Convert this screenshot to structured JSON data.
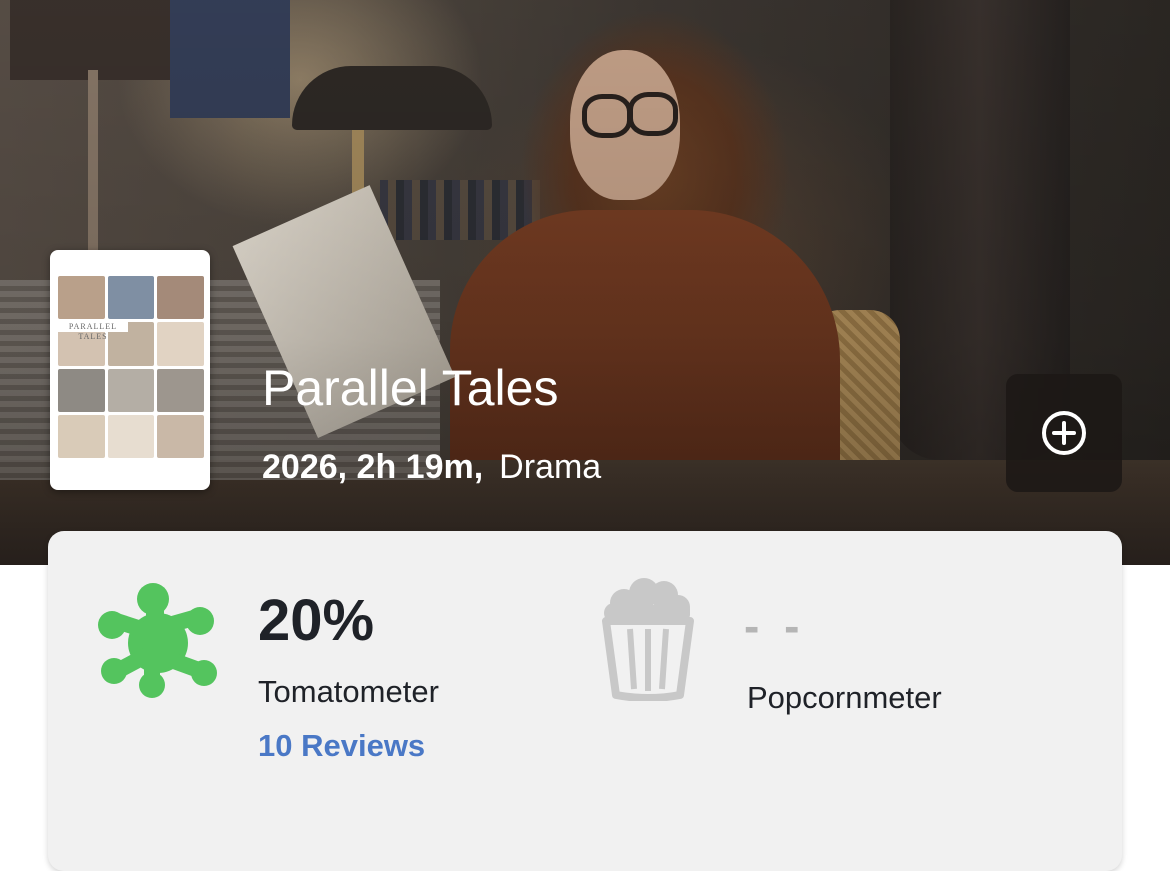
{
  "movie": {
    "title": "Parallel Tales",
    "year_runtime": "2026, 2h 19m,",
    "genre": "Drama",
    "poster": {
      "title_text": "PARALLEL TALES",
      "palette": [
        "#b9a08a",
        "#7f8fa3",
        "#a48a79",
        "#d3c2b1",
        "#c1b2a0",
        "#e1d3c3",
        "#8e8a84",
        "#b4aea5",
        "#9d968e",
        "#d9cbb8",
        "#e7ddd0",
        "#c9b8a7"
      ]
    }
  },
  "actions": {
    "add_icon": "plus-circle-icon"
  },
  "scores": {
    "tomatometer": {
      "value": "20%",
      "label": "Tomatometer",
      "reviews": "10 Reviews",
      "icon": "rotten-splat-icon",
      "icon_color": "#54c45e"
    },
    "popcornmeter": {
      "value": "- -",
      "label": "Popcornmeter",
      "icon": "popcorn-bucket-icon",
      "icon_color": "#c8c8c8"
    }
  },
  "colors": {
    "card_background": "#f1f1f1",
    "link": "#4a78c6",
    "text": "#1f2228",
    "placeholder": "#b5b5b5"
  }
}
